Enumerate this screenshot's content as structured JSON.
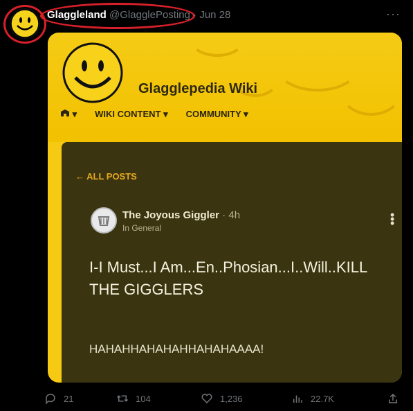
{
  "tweet": {
    "display_name": "Glaggleland",
    "handle": "@GlagglePosting",
    "separator": "·",
    "date": "Jun 28",
    "more_label": "···"
  },
  "media": {
    "wiki_title": "Glagglepedia Wiki",
    "nav": [
      "▾",
      "WIKI CONTENT ▾",
      "COMMUNITY ▾"
    ],
    "back_link": "← ALL POSTS",
    "author_name": "The Joyous Giggler",
    "author_time": "· 4h",
    "author_category": "In General",
    "post_title": "I-I Must...I Am...En..Phosian...I..Will..KILL THE GIGGLERS",
    "post_body": "HAHAHHAHAHAHHAHAHAAAA!"
  },
  "actions": {
    "replies": "21",
    "retweets": "104",
    "likes": "1,236",
    "views": "22.7K"
  },
  "colors": {
    "accent_red": "#d8202a",
    "wiki_yellow": "#f6c912",
    "post_bg": "#3a3510"
  }
}
